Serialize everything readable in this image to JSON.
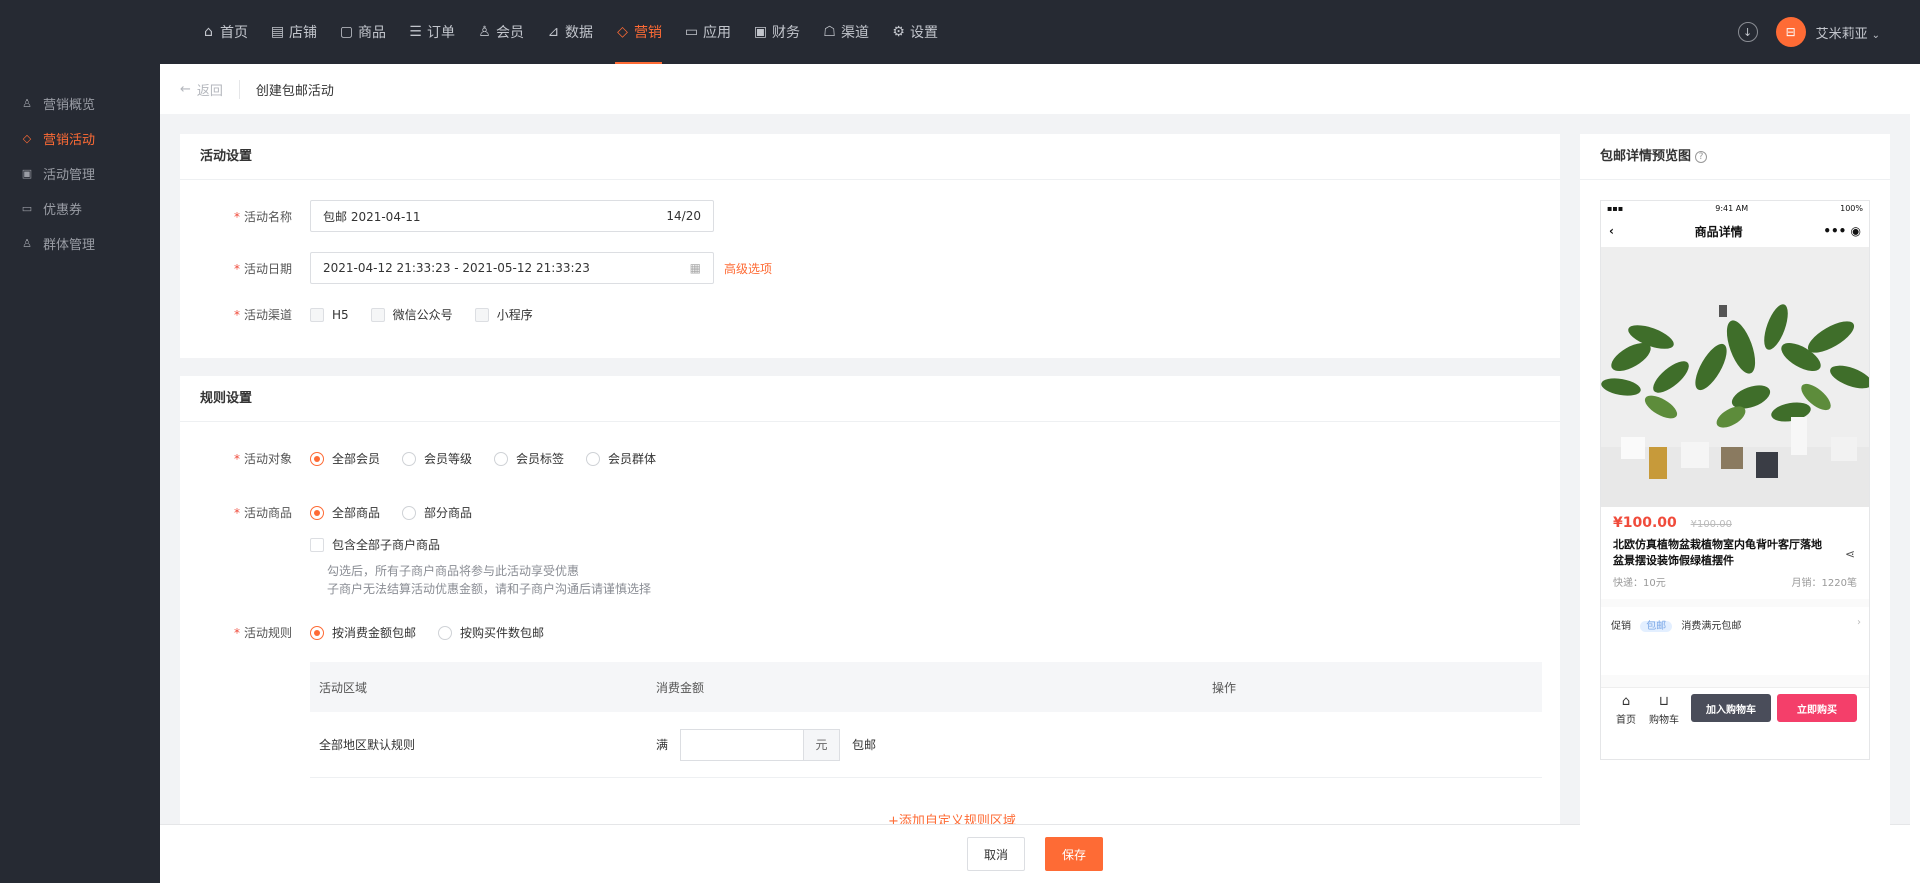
{
  "nav": {
    "items": [
      {
        "label": "首页",
        "icon": "home-icon"
      },
      {
        "label": "店铺",
        "icon": "shop-icon"
      },
      {
        "label": "商品",
        "icon": "product-icon"
      },
      {
        "label": "订单",
        "icon": "order-icon"
      },
      {
        "label": "会员",
        "icon": "member-icon"
      },
      {
        "label": "数据",
        "icon": "chart-icon"
      },
      {
        "label": "营销",
        "icon": "tag-icon"
      },
      {
        "label": "应用",
        "icon": "app-icon"
      },
      {
        "label": "财务",
        "icon": "finance-icon"
      },
      {
        "label": "渠道",
        "icon": "channel-icon"
      },
      {
        "label": "设置",
        "icon": "gear-icon"
      }
    ],
    "active_index": 6,
    "user_name": "艾米莉亚",
    "avatar_glyph": "⊟"
  },
  "sidebar": {
    "items": [
      {
        "label": "营销概览"
      },
      {
        "label": "营销活动"
      },
      {
        "label": "活动管理"
      },
      {
        "label": "优惠券"
      },
      {
        "label": "群体管理"
      }
    ],
    "active_index": 1
  },
  "subheader": {
    "back_label": "返回",
    "title": "创建包邮活动"
  },
  "activity": {
    "title": "活动设置",
    "name_label": "活动名称",
    "name_value": "包邮 2021-04-11",
    "name_count": "14/20",
    "date_label": "活动日期",
    "date_value": "2021-04-12 21:33:23 - 2021-05-12 21:33:23",
    "advanced_label": "高级选项",
    "channel_label": "活动渠道",
    "channels": [
      "H5",
      "微信公众号",
      "小程序"
    ]
  },
  "rules": {
    "title": "规则设置",
    "target_label": "活动对象",
    "targets": [
      "全部会员",
      "会员等级",
      "会员标签",
      "会员群体"
    ],
    "target_selected": 0,
    "goods_label": "活动商品",
    "goods": [
      "全部商品",
      "部分商品"
    ],
    "goods_selected": 0,
    "include_sub_label": "包含全部子商户商品",
    "hint_line1": "勾选后，所有子商户商品将参与此活动享受优惠",
    "hint_line2": "子商户无法结算活动优惠金额，请和子商户沟通后请谨慎选择",
    "rule_label": "活动规则",
    "rule_options": [
      "按消费金额包邮",
      "按购买件数包邮"
    ],
    "rule_selected": 0,
    "table": {
      "headers": [
        "活动区域",
        "消费金额",
        "操作"
      ],
      "row": {
        "region": "全部地区默认规则",
        "prefix": "满",
        "unit": "元",
        "suffix": "包邮",
        "value": ""
      }
    },
    "add_region_label": "+添加自定义规则区域"
  },
  "footer": {
    "cancel_label": "取消",
    "save_label": "保存"
  },
  "preview": {
    "title": "包邮详情预览图",
    "status_time": "9:41 AM",
    "status_battery": "100%",
    "page_title": "商品详情",
    "price": "¥100.00",
    "original_price": "¥100.00",
    "product_name": "北欧仿真植物盆栽植物室内龟背叶客厅落地盆景摆设装饰假绿植摆件",
    "shipping": "快递：10元",
    "monthly_sales": "月销：1220笔",
    "promo_label": "促销",
    "promo_tag": "包邮",
    "promo_text": "消费满元包邮",
    "bottom_home": "首页",
    "bottom_cart": "购物车",
    "add_cart_label": "加入购物车",
    "buy_now_label": "立即购买"
  },
  "colors": {
    "accent": "#fe6b35",
    "nav_bg": "#262a33",
    "buy_now": "#f43f6a",
    "add_cart": "#4a4d5a"
  }
}
